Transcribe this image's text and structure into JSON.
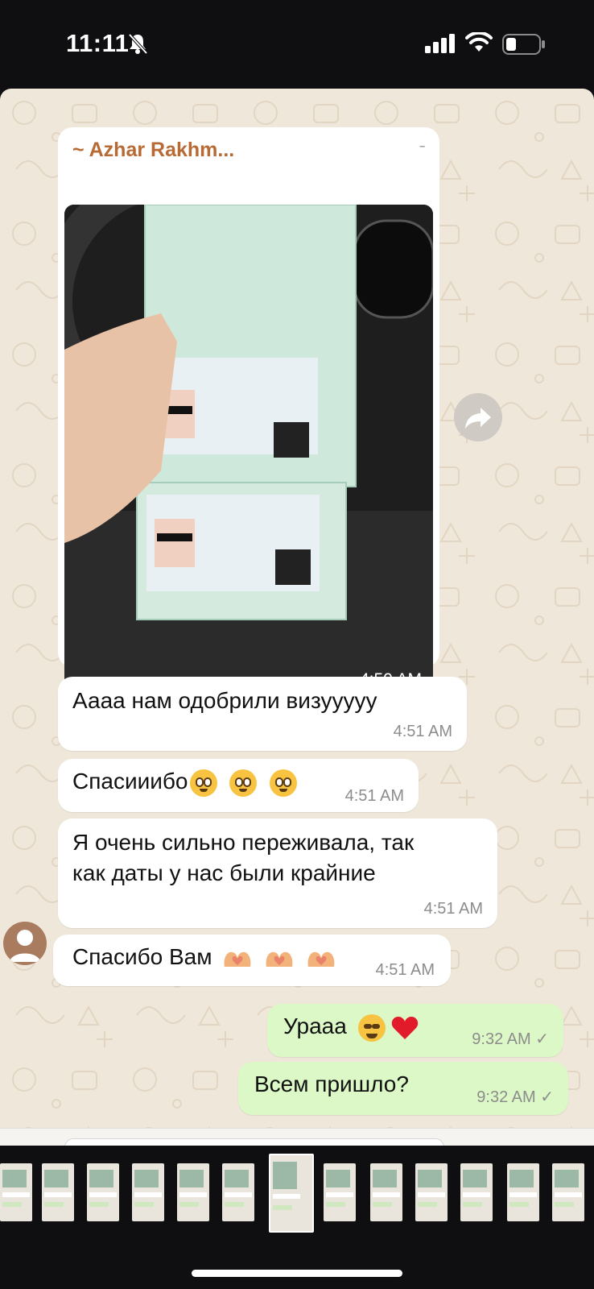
{
  "status_bar": {
    "time": "11:11"
  },
  "chat": {
    "image_message": {
      "sender": "~ Azhar Rakhm...",
      "time": "4:50 AM"
    },
    "messages": [
      {
        "text": "Аааа нам одобрили визууууу",
        "time": "4:51 AM",
        "direction": "in"
      },
      {
        "text": "Спасииибо",
        "emoji": "pleading-face x3",
        "time": "4:51 AM",
        "direction": "in"
      },
      {
        "text_line1": "Я очень сильно переживала, так",
        "text_line2": "как даты у нас были крайние",
        "time": "4:51 AM",
        "direction": "in"
      },
      {
        "text": "Спасибо Вам",
        "emoji": "heart-hands x3",
        "time": "4:51 AM",
        "direction": "in"
      },
      {
        "text": "Урааа",
        "emoji": "smiling-face red-heart",
        "time": "9:32 AM",
        "direction": "out",
        "status": "✓"
      },
      {
        "text": "Всем пришло?",
        "time": "9:32 AM",
        "direction": "out",
        "status": "✓"
      }
    ]
  },
  "colors": {
    "chat_bg": "#efe7da",
    "incoming": "#ffffff",
    "outgoing": "#dcf8c6",
    "sender_name": "#b86a34"
  },
  "icons": [
    "bell-slash-icon",
    "signal-icon",
    "wifi-icon",
    "battery-icon",
    "forward-icon",
    "avatar-icon"
  ]
}
